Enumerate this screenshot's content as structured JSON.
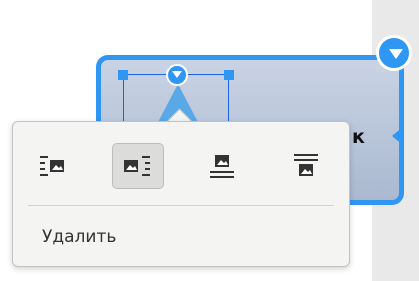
{
  "background": {
    "card_text": "к"
  },
  "context_menu": {
    "wrap_options": [
      {
        "icon": "wrap-left-icon",
        "active": false
      },
      {
        "icon": "wrap-right-icon",
        "active": true
      },
      {
        "icon": "wrap-top-bottom-icon",
        "active": false
      },
      {
        "icon": "wrap-behind-text-icon",
        "active": false
      }
    ],
    "delete_label": "Удалить"
  },
  "colors": {
    "accent": "#2f96f3",
    "selection_border": "#1e63e6",
    "popup_bg": "#f4f4f3",
    "active_button_bg": "#dcdcda"
  }
}
